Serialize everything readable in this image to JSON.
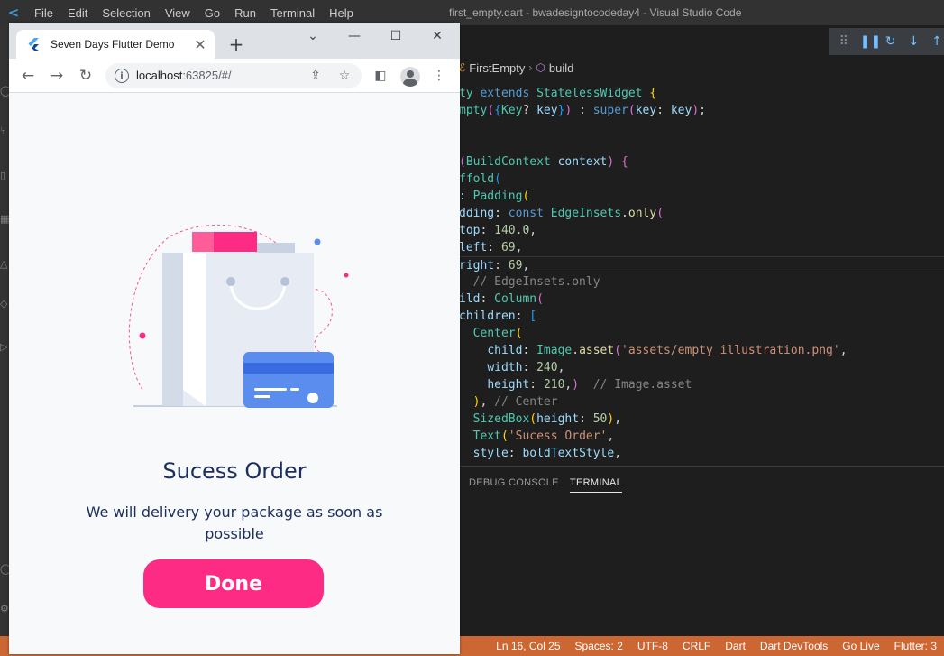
{
  "vscode": {
    "logo": "vscode-logo",
    "menu": [
      "File",
      "Edit",
      "Selection",
      "View",
      "Go",
      "Run",
      "Terminal",
      "Help"
    ],
    "window_title": "first_empty.dart - bwadesigntocodeday4 - Visual Studio Code",
    "breadcrumb": {
      "item1": "FirstEmpty",
      "item2": "build"
    },
    "panel_tabs": {
      "debug_console": "DEBUG CONSOLE",
      "terminal": "TERMINAL"
    },
    "status": [
      "Ln 16, Col 25",
      "Spaces: 2",
      "UTF-8",
      "CRLF",
      "Dart",
      "Dart DevTools",
      "Go Live",
      "Flutter: 3"
    ],
    "code_lines": [
      "ty extends StatelessWidget {",
      "mpty({Key? key}) : super(key: key);",
      "",
      "",
      "(BuildContext context) {",
      "ffold(",
      ": Padding(",
      "dding: const EdgeInsets.only(",
      "top: 140.0,",
      "left: 69,",
      "right: 69,",
      "  // EdgeInsets.only",
      "ild: Column(",
      "children: [",
      "  Center(",
      "    child: Image.asset('assets/empty_illustration.png',",
      "    width: 240,",
      "    height: 210,)  // Image.asset",
      "  ), // Center",
      "  SizedBox(height: 50),",
      "  Text('Sucess Order',",
      "  style: boldTextStyle,"
    ]
  },
  "browser": {
    "tab_title": "Seven Days Flutter Demo",
    "url_host": "localhost",
    "url_rest": ":63825/#/",
    "page": {
      "heading": "Sucess Order",
      "message": "We will delivery your package as soon as possible",
      "button_label": "Done"
    },
    "colors": {
      "accent": "#fe2b84",
      "heading": "#1c2e5e",
      "card": "#5b8def"
    }
  }
}
